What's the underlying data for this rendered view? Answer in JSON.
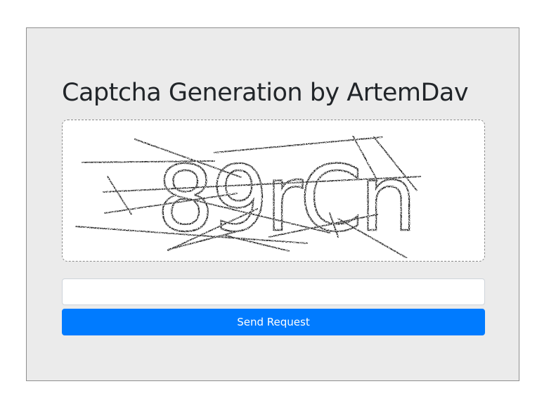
{
  "page": {
    "title": "Captcha Generation by ArtemDav"
  },
  "captcha": {
    "text": "89rCn",
    "image_alt": "captcha image"
  },
  "form": {
    "input_value": "",
    "input_placeholder": "",
    "submit_label": "Send Request"
  },
  "colors": {
    "panel_background": "#ebebeb",
    "accent": "#007bff",
    "text": "#212529"
  }
}
